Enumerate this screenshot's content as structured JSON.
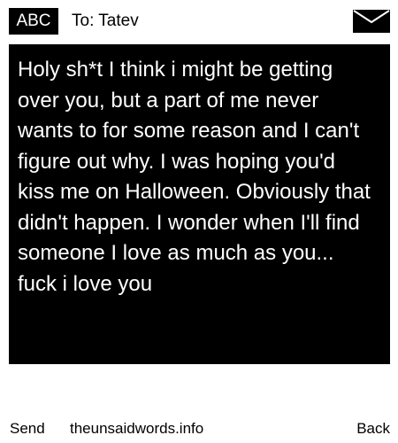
{
  "header": {
    "mode_label": "ABC",
    "recipient_label": "To: Tatev",
    "envelope_icon": "envelope-icon"
  },
  "message": {
    "body": "Holy sh*t I think i might be getting over you, but a part of me never wants to for some reason and I can't figure out why. I was hoping you'd kiss me on Halloween. Obviously that didn't happen. I wonder when I'll find someone I love as much as you... fuck i love you"
  },
  "footer": {
    "send_label": "Send",
    "site_label": "theunsaidwords.info",
    "back_label": "Back"
  },
  "colors": {
    "background": "#ffffff",
    "message_background": "#000000",
    "message_text": "#ffffff",
    "text": "#000000"
  }
}
